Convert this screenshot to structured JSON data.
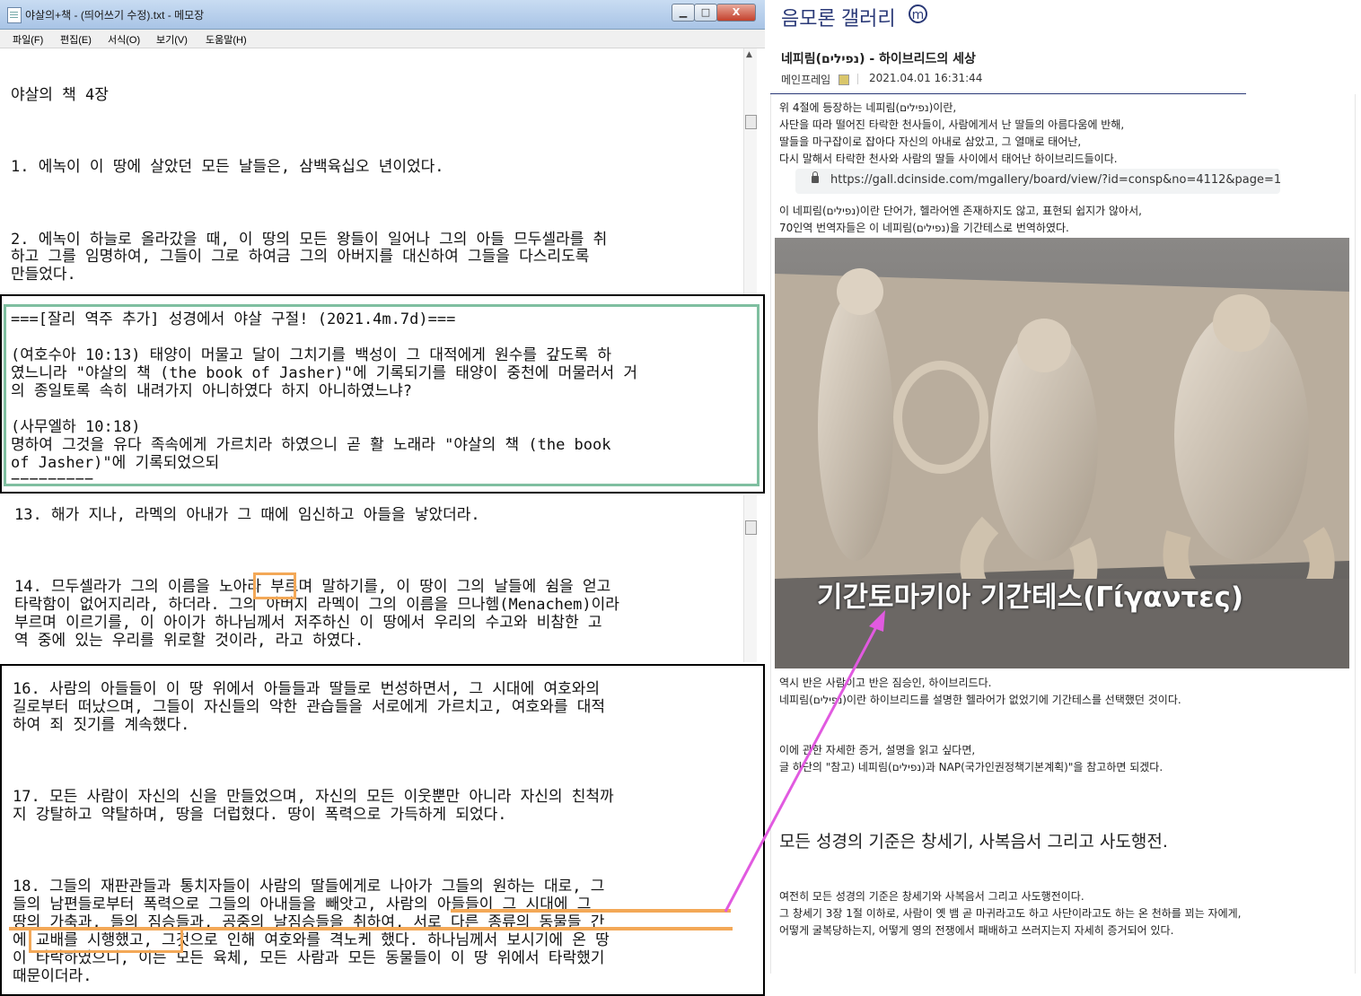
{
  "notepad": {
    "title": "야살의+책 - (띄어쓰기 수정).txt - 메모장",
    "window_buttons": {
      "minimize": "▁",
      "maximize": "□",
      "close": "X"
    },
    "menu": [
      "파일(F)",
      "편집(E)",
      "서식(O)",
      "보기(V)",
      "도움말(H)"
    ],
    "section1": [
      "야살의 책 4장",
      "1. 에녹이 이 땅에 살았던 모든 날들은, 삼백육십오 년이었다.",
      "2. 에녹이 하늘로 올라갔을 때, 이 땅의 모든 왕들이 일어나 그의 아들 므두셀라를 취",
      "하고 그를 임명하여, 그들이 그로 하여금 그의 아버지를 대신하여 그들을 다스리도록",
      "만들었다."
    ],
    "section2": [
      "===[잘리 역주 추가] 성경에서 야살 구절! (2021.4m.7d)===",
      "(여호수아 10:13) 태양이 머물고 달이 그치기를 백성이 그 대적에게 원수를 갚도록 하",
      "였느니라 \"야살의 책 (the book of Jasher)\"에 기록되기를 태양이 중천에 머물러서 거",
      "의 종일토록 속히 내려가지 아니하였다 하지 아니하였느냐?",
      "(사무엘하 10:18)",
      "명하여 그것을 유다 족속에게 가르치라 하였으니 곧 활 노래라 \"야살의 책 (the book",
      "of Jasher)\"에 기록되었으되",
      "========="
    ],
    "section3": [
      "13. 해가 지나, 라멕의 아내가 그 때에 임신하고 아들을 낳았더라.",
      "14. 므두셀라가 그의 이름을 노아라 부르며 말하기를, 이 땅이 그의 날들에 쉼을 얻고",
      "타락함이 없어지리라, 하더라. 그의 아버지 라멕이 그의 이름을 므나헴(Menachem)이라",
      "부르며 이르기를, 이 아이가 하나님께서 저주하신 이 땅에서 우리의 수고와 비참한 고",
      "역 중에 있는 우리를 위로할 것이라, 라고 하였다."
    ],
    "section4": [
      "16. 사람의 아들들이 이 땅 위에서 아들들과 딸들로 번성하면서, 그 시대에 여호와의",
      "길로부터 떠났으며, 그들이 자신들의 악한 관습들을 서로에게 가르치고, 여호와를 대적",
      "하여 죄 짓기를 계속했다.",
      "17. 모든 사람이 자신의 신을 만들었으며, 자신의 모든 이웃뿐만 아니라 자신의 친척까",
      "지 강탈하고 약탈하며, 땅을 더럽혔다. 땅이 폭력으로 가득하게 되었다.",
      "18. 그들의 재판관들과 통치자들이 사람의 딸들에게로 나아가 그들의 원하는 대로, 그",
      "들의 남편들로부터 폭력으로 그들의 아내들을 빼앗고, 사람의 아들들이 그 시대에 그",
      "땅의 가축과, 들의 짐승들과, 공중의 날짐승들을 취하여, 서로 다른 종류의 동물들 간",
      "에 교배를 시행했고, 그것으로 인해 여호와를 격노케 했다. 하나님께서 보시기에 온 땅",
      "이 타락하였으니, 이는 모든 육체, 모든 사람과 모든 동물들이 이 땅 위에서 타락했기",
      "때문이더라."
    ]
  },
  "article": {
    "gallery_title": "음모론 갤러리",
    "gallery_badge": "m",
    "post_title": "네피림(נפילים) - 하이브리드의 세상",
    "author": "메인프레임",
    "date": "2021.04.01 16:31:44",
    "paragraph1": [
      "위 4절에 등장하는 네피림(נפילים)이란,",
      "사단을 따라 떨어진 타락한 천사들이, 사람에게서 난 딸들의 아름다움에 반해,",
      "딸들을 마구잡이로 잡아다 자신의 아내로 삼았고, 그 열매로 태어난,",
      "다시 말해서 타락한 천사와 사람의 딸들 사이에서 태어난 하이브리드들이다."
    ],
    "url": "https://gall.dcinside.com/mgallery/board/view/?id=consp&no=4112&page=1",
    "paragraph2": [
      "이 네피림(נפילים)이란 단어가, 헬라어엔 존재하지도 않고, 표현되 쉽지가 않아서,",
      "70인역 번역자들은 이 네피림(נפילים)을 기간테스로 번역하였다."
    ],
    "image_caption": "기간토마키아 기간테스(Γίγαντες)",
    "paragraph3": [
      "역시 반은 사람이고 반은 짐승인, 하이브리드다.",
      "네피림(נפילים)이란 하이브리드를 설명한 헬라어가 없었기에 기간테스를 선택했던 것이다."
    ],
    "paragraph4": [
      "이에 관한 자세한 증거, 설명을 읽고 싶다면,",
      "글 하단의 \"참고) 네피림(נפילים)과 NAP(국가인권정책기본계획)\"을 참고하면 되겠다."
    ],
    "section_heading": "모든 성경의 기준은 창세기, 사복음서 그리고 사도행전.",
    "paragraph5": [
      "여전히 모든 성경의 기준은 창세기와 사복음서 그리고 사도행전이다.",
      "그 창세기 3장 1절 이하로, 사람이 옛 뱀 곧 마귀라고도 하고 사단이라고도 하는 온 천하를 꾀는 자에게,",
      "어떻게 굴복당하는지, 어떻게 영의 전쟁에서 패배하고 쓰러지는지 자세히 증거되어 있다."
    ]
  },
  "colors": {
    "highlight_orange": "#f3a857",
    "frame_green": "#7fbfa0",
    "arrow_magenta": "#e15ae0",
    "gallery_navy": "#2b3a78"
  }
}
